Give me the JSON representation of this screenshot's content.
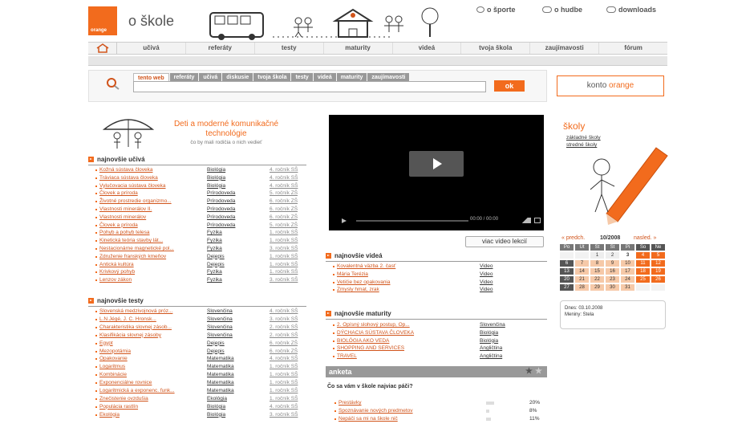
{
  "header": {
    "logo_text": "orange",
    "site_title": "o škole",
    "links": [
      "o športe",
      "o hudbe",
      "downloads"
    ]
  },
  "nav": {
    "items": [
      "učivá",
      "referáty",
      "testy",
      "maturity",
      "videá",
      "tvoja škola",
      "zaujímavosti",
      "fórum"
    ]
  },
  "search": {
    "tabs": [
      "tento web",
      "referáty",
      "učivá",
      "diskusie",
      "tvoja škola",
      "testy",
      "videá",
      "maturity",
      "zaujímavosti"
    ],
    "input_value": "",
    "ok_label": "ok"
  },
  "konto": {
    "label": "konto",
    "brand": "orange"
  },
  "promo": {
    "title": "Deti a moderné komunikačné technológie",
    "subtitle": "čo by mali rodičia o nich vedieť"
  },
  "ucivo": {
    "heading": "najnovšie učivá",
    "rows": [
      [
        "Kožná sústava človeka",
        "Biológia",
        "4. ročník SŠ"
      ],
      [
        "Tráviaca sústava človeka",
        "Biológia",
        "4. ročník SŠ"
      ],
      [
        "Vylučovacia sústava človeka",
        "Biológia",
        "4. ročník SŠ"
      ],
      [
        "Človek a príroda",
        "Prírodoveda",
        "5. ročník ZŠ"
      ],
      [
        "Životné prostredie organizmo...",
        "Prírodoveda",
        "6. ročník ZŠ"
      ],
      [
        "Vlastnosti minerálov II.",
        "Prírodoveda",
        "6. ročník ZŠ"
      ],
      [
        "Vlastnosti minerálov",
        "Prírodoveda",
        "6. ročník ZŠ"
      ],
      [
        "Človek a príroda",
        "Prírodoveda",
        "5. ročník ZŠ"
      ],
      [
        "Pohyb a pohyb telesa",
        "Fyzika",
        "1. ročník SŠ"
      ],
      [
        "Kinetická teória stavby lát...",
        "Fyzika",
        "1. ročník SŠ"
      ],
      [
        "Nestacionárne magnetické pol...",
        "Fyzika",
        "3. ročník SŠ"
      ],
      [
        "Združenie franských kmeňov",
        "Dejepis",
        "1. ročník SŠ"
      ],
      [
        "Antická kultúra",
        "Dejepis",
        "1. ročník SŠ"
      ],
      [
        "Krivkový pohyb",
        "Fyzika",
        "1. ročník SŠ"
      ],
      [
        "Lenzov zákon",
        "Fyzika",
        "3. ročník SŠ"
      ]
    ]
  },
  "testy": {
    "heading": "najnovšie testy",
    "rows": [
      [
        "Slovenská medzivojnová próz...",
        "Slovenčina",
        "4. ročník SŠ"
      ],
      [
        "L.N.Jégé, J. C. Hronsk...",
        "Slovenčina",
        "3. ročník SŠ"
      ],
      [
        "Charakteristika slovnej zásob...",
        "Slovenčina",
        "2. ročník SŠ"
      ],
      [
        "Klasifikácia slovnej zásoby",
        "Slovenčina",
        "2. ročník SŠ"
      ],
      [
        "Egypt",
        "Dejepis",
        "6. ročník ZŠ"
      ],
      [
        "Mezopotámia",
        "Dejepis",
        "6. ročník ZŠ"
      ],
      [
        "Opakovanie",
        "Matematika",
        "4. ročník SŠ"
      ],
      [
        "Logaritmus",
        "Matematika",
        "1. ročník SŠ"
      ],
      [
        "Kombinácie",
        "Matematika",
        "1. ročník SŠ"
      ],
      [
        "Exponenciálne rovnice",
        "Matematika",
        "1. ročník SŠ"
      ],
      [
        "Logaritmická a exponenc. funk...",
        "Matematika",
        "1. ročník SŠ"
      ],
      [
        "Znečistenie ovzdušia",
        "Ekológia",
        "1. ročník SŠ"
      ],
      [
        "Populácia rastlín",
        "Biológia",
        "4. ročník SŠ"
      ],
      [
        "Ekológia",
        "Biológia",
        "3. ročník SŠ"
      ]
    ]
  },
  "video": {
    "time": "00:00 / 00:00",
    "more_label": "viac video lekcií"
  },
  "videa": {
    "heading": "najnovšie videá",
    "rows": [
      [
        "Kovalentná väzba 2. časť",
        "Video"
      ],
      [
        "Mária Terézia",
        "Video"
      ],
      [
        "Vetičie bez opakovania",
        "Video"
      ],
      [
        "Zmysly hmat, zrak",
        "Video"
      ]
    ]
  },
  "maturity": {
    "heading": "najnovšie maturity",
    "rows": [
      [
        "2. Opísný slohový postup, Op...",
        "Slovenčina"
      ],
      [
        "DÝCHACIA SÚSTAVA ČLOVEKA",
        "Biológia"
      ],
      [
        "BIOLÓGIA AKO VEDA",
        "Biológia"
      ],
      [
        "SHOPPING AND SERVICES",
        "Angličtina"
      ],
      [
        "TRAVEL",
        "Angličtina"
      ]
    ]
  },
  "anketa": {
    "title": "anketa",
    "question": "Čo sa vám v škole najviac páči?",
    "options": [
      {
        "label": "Prestávky",
        "percent": 20
      },
      {
        "label": "Spoznávanie nových predmetov",
        "percent": 8
      },
      {
        "label": "Nepáči sa mi na škole nič",
        "percent": 11
      }
    ]
  },
  "skoly": {
    "title": "školy",
    "links": [
      "základné školy",
      "stredné školy"
    ]
  },
  "calendar": {
    "prev": "« predch.",
    "month": "10/2008",
    "next": "nasled. »",
    "days": [
      "Po",
      "Ut",
      "St",
      "Št",
      "Pi",
      "So",
      "Ne"
    ],
    "weeks": [
      [
        "",
        "",
        "1",
        "2",
        "3",
        "4",
        "5"
      ],
      [
        "6",
        "7",
        "8",
        "9",
        "10",
        "11",
        "12"
      ],
      [
        "13",
        "14",
        "15",
        "16",
        "17",
        "18",
        "19"
      ],
      [
        "20",
        "21",
        "22",
        "23",
        "24",
        "25",
        "26"
      ],
      [
        "27",
        "28",
        "29",
        "30",
        "31",
        "",
        ""
      ]
    ]
  },
  "today": {
    "date_line": "Dnes: 03.10.2008",
    "names_line": "Meniny: Stela"
  }
}
